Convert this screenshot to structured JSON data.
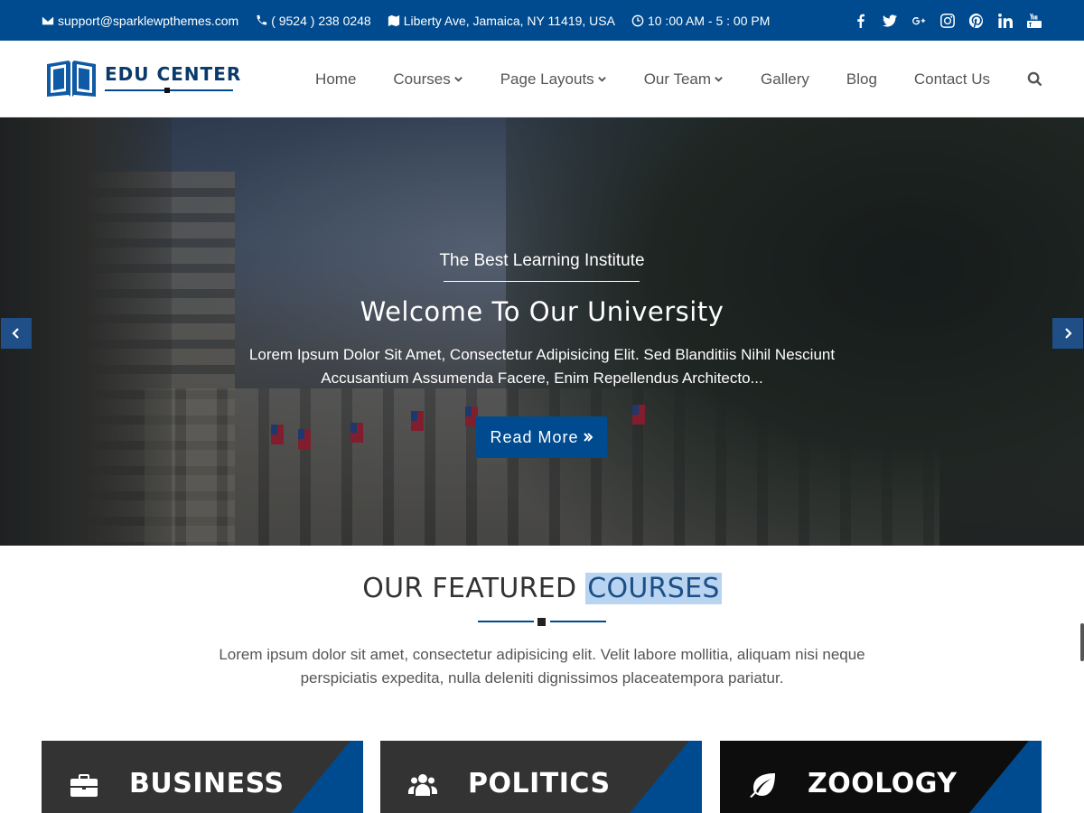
{
  "topbar": {
    "email": "support@sparklewpthemes.com",
    "phone": "( 9524 ) 238 0248",
    "address": "Liberty Ave, Jamaica, NY 11419, USA",
    "hours": "10 :00 AM - 5 : 00 PM",
    "social": [
      {
        "name": "facebook-icon"
      },
      {
        "name": "twitter-icon"
      },
      {
        "name": "google-plus-icon"
      },
      {
        "name": "instagram-icon"
      },
      {
        "name": "pinterest-icon"
      },
      {
        "name": "linkedin-icon"
      },
      {
        "name": "youtube-icon"
      }
    ]
  },
  "header": {
    "logo_text": "EDU CENTER",
    "nav": [
      {
        "label": "Home",
        "dropdown": false
      },
      {
        "label": "Courses",
        "dropdown": true
      },
      {
        "label": "Page Layouts",
        "dropdown": true
      },
      {
        "label": "Our Team",
        "dropdown": true
      },
      {
        "label": "Gallery",
        "dropdown": false
      },
      {
        "label": "Blog",
        "dropdown": false
      },
      {
        "label": "Contact Us",
        "dropdown": false
      }
    ]
  },
  "hero": {
    "kicker": "The Best Learning Institute",
    "title": "Welcome To Our University",
    "description": "Lorem Ipsum Dolor Sit Amet, Consectetur Adipisicing Elit. Sed Blanditiis Nihil Nesciunt Accusantium Assumenda Facere, Enim Repellendus Architecto...",
    "button_label": "Read More"
  },
  "featured": {
    "title_plain": "OUR FEATURED ",
    "title_highlight": "COURSES",
    "description": "Lorem ipsum dolor sit amet, consectetur adipisicing elit. Velit labore mollitia, aliquam nisi neque perspiciatis expedita, nulla deleniti dignissimos placeatempora pariatur."
  },
  "courses": [
    {
      "label": "BUSINESS",
      "icon": "briefcase-icon"
    },
    {
      "label": "POLITICS",
      "icon": "users-icon"
    },
    {
      "label": "ZOOLOGY",
      "icon": "leaf-icon"
    }
  ],
  "colors": {
    "primary": "#004b8f",
    "card_gray": "#333333",
    "card_dark": "#0d0d0d",
    "highlight": "#b8d4f0"
  }
}
